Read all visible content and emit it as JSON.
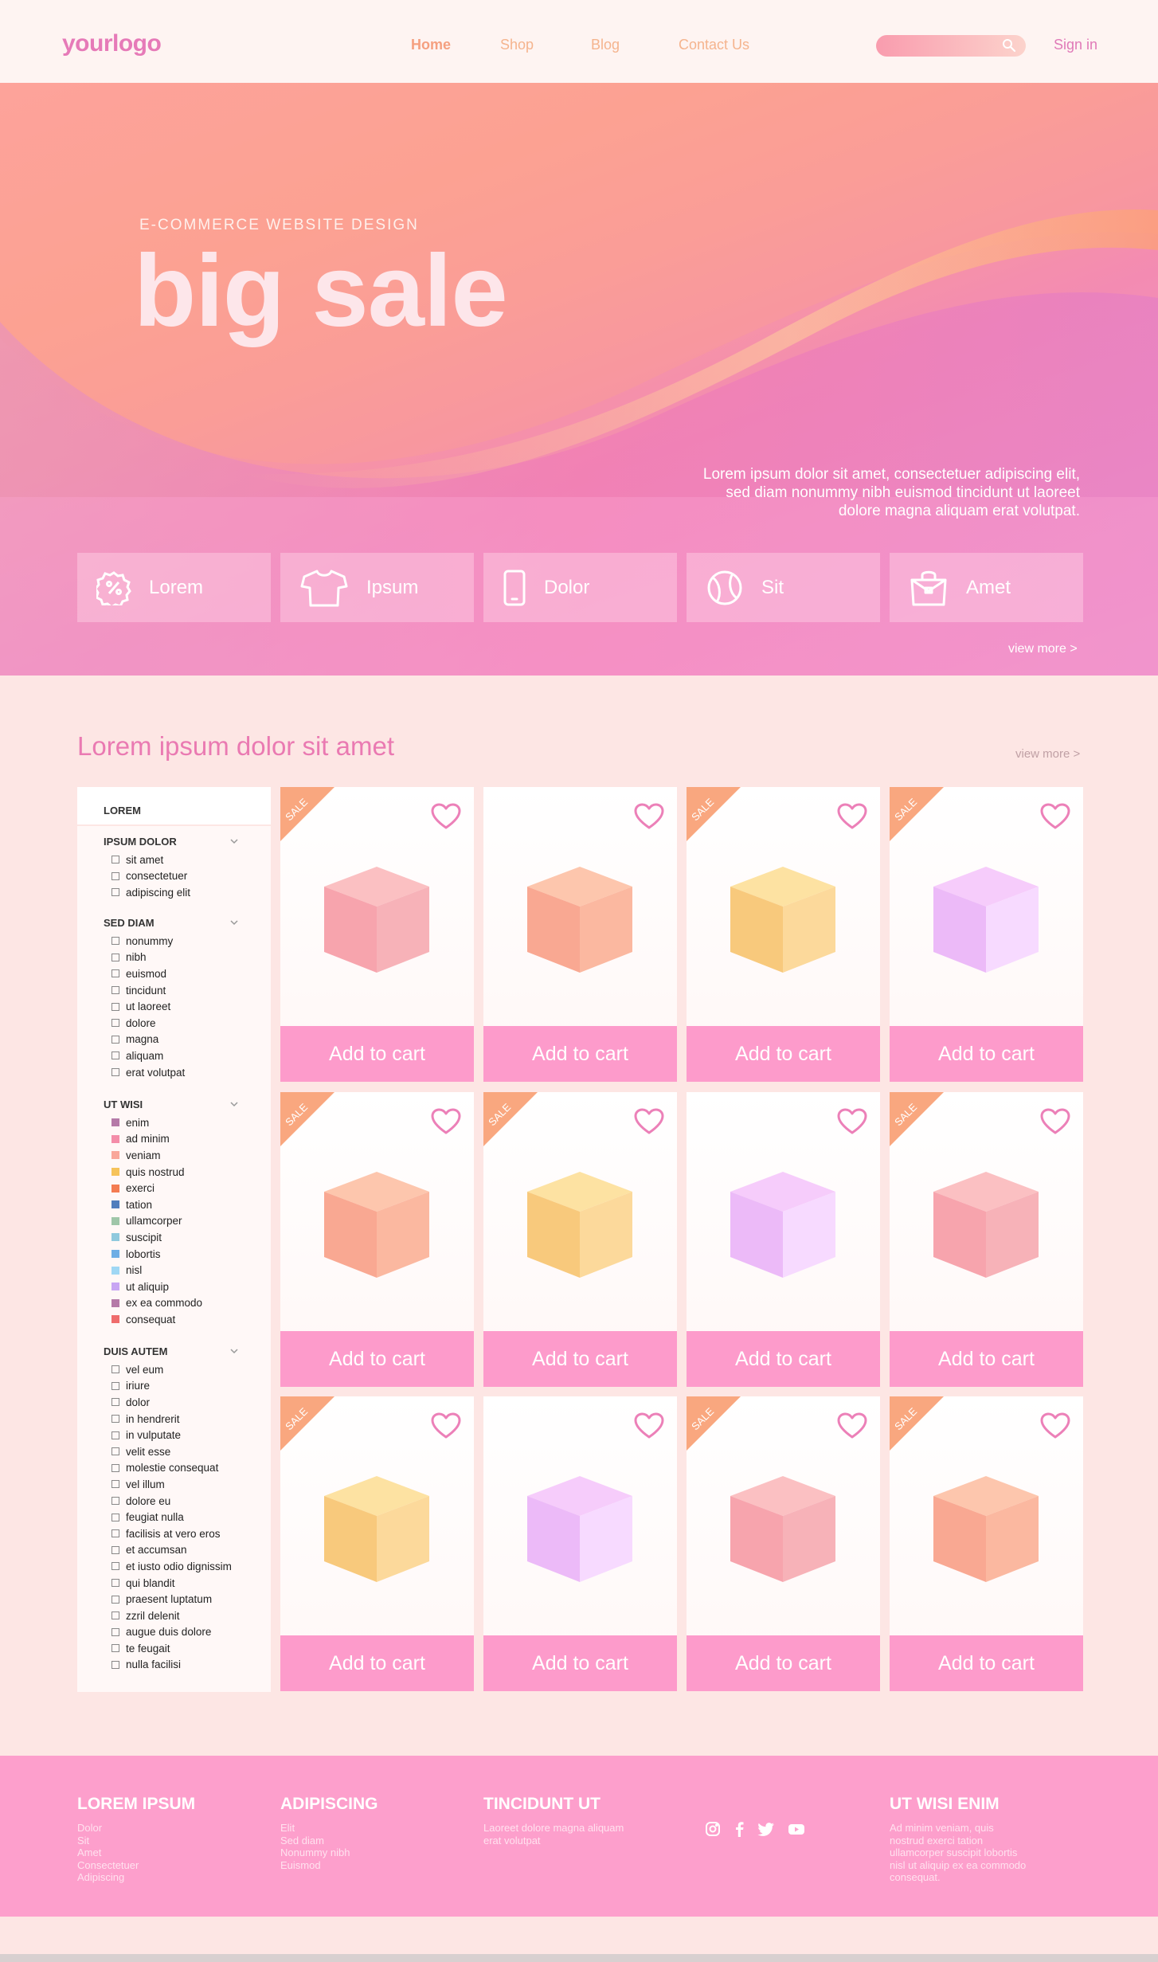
{
  "header": {
    "logo": "yourlogo",
    "nav": [
      "Home",
      "Shop",
      "Blog",
      "Contact Us"
    ],
    "sign_in": "Sign in"
  },
  "hero": {
    "subtitle": "E-COMMERCE WEBSITE DESIGN",
    "title": "big sale",
    "description": "Lorem ipsum dolor sit amet, consectetuer adipiscing elit, sed diam nonummy nibh euismod tincidunt ut laoreet dolore magna aliquam erat volutpat.",
    "categories": [
      {
        "label": "Lorem",
        "icon": "discount-badge-icon"
      },
      {
        "label": "Ipsum",
        "icon": "tshirt-icon"
      },
      {
        "label": "Dolor",
        "icon": "smartphone-icon"
      },
      {
        "label": "Sit",
        "icon": "ball-icon"
      },
      {
        "label": "Amet",
        "icon": "shopping-bag-icon"
      }
    ],
    "view_more": "view more >"
  },
  "section": {
    "title": "Lorem ipsum dolor sit amet",
    "view_more": "view more >"
  },
  "sidebar": {
    "header": "LOREM",
    "groups": [
      {
        "title": "IPSUM DOLOR",
        "items": [
          "sit amet",
          "consectetuer",
          "adipiscing elit"
        ]
      },
      {
        "title": "SED DIAM",
        "items": [
          "nonummy",
          "nibh",
          "euismod",
          "tincidunt",
          "ut laoreet",
          "dolore",
          "magna",
          "aliquam",
          "erat volutpat"
        ]
      },
      {
        "title": "UT WISI",
        "items": [
          "enim",
          "ad minim",
          "veniam",
          "quis nostrud",
          "exerci",
          "tation",
          "ullamcorper",
          "suscipit",
          "lobortis",
          "nisl",
          "ut aliquip",
          "ex ea commodo",
          "consequat"
        ],
        "colors": [
          "#b57aa8",
          "#f48da9",
          "#f9a79a",
          "#f6c35a",
          "#f47c52",
          "#4f7fbd",
          "#9fc6a9",
          "#8fc9dd",
          "#6eaee5",
          "#9fd7f4",
          "#c8a6f3",
          "#b57aa8",
          "#ef6c6c"
        ]
      },
      {
        "title": "DUIS AUTEM",
        "items": [
          "vel eum",
          "iriure",
          "dolor",
          "in hendrerit",
          "in vulputate",
          "velit esse",
          "molestie consequat",
          "vel illum",
          "dolore eu",
          "feugiat nulla",
          "facilisis at vero eros",
          "et accumsan",
          "et iusto odio dignissim",
          "qui blandit",
          "praesent luptatum",
          "zzril delenit",
          "augue duis dolore",
          "te feugait",
          "nulla facilisi"
        ]
      }
    ]
  },
  "products": [
    {
      "sale": true,
      "color": "pink"
    },
    {
      "sale": false,
      "color": "peach"
    },
    {
      "sale": true,
      "color": "yellow"
    },
    {
      "sale": true,
      "color": "lilac"
    },
    {
      "sale": true,
      "color": "peach"
    },
    {
      "sale": true,
      "color": "yellow"
    },
    {
      "sale": false,
      "color": "lilac"
    },
    {
      "sale": true,
      "color": "pink"
    },
    {
      "sale": true,
      "color": "yellow"
    },
    {
      "sale": false,
      "color": "lilac"
    },
    {
      "sale": true,
      "color": "pink"
    },
    {
      "sale": true,
      "color": "peach"
    }
  ],
  "product_labels": {
    "add_to_cart": "Add to cart",
    "sale": "SALE"
  },
  "footer": {
    "columns": [
      {
        "title": "LOREM IPSUM",
        "lines": [
          "Dolor",
          "Sit",
          "Amet",
          "Consectetuer",
          "Adipiscing"
        ]
      },
      {
        "title": "ADIPISCING",
        "lines": [
          "Elit",
          "Sed diam",
          "Nonummy nibh",
          "Euismod"
        ]
      },
      {
        "title": "TINCIDUNT UT",
        "lines": [
          "Laoreet dolore magna aliquam",
          "erat volutpat"
        ]
      },
      {
        "title": "UT WISI ENIM",
        "lines": [
          "Ad minim veniam, quis",
          "nostrud exerci tation",
          "ullamcorper suscipit lobortis",
          "nisl ut aliquip ex ea commodo",
          "consequat."
        ]
      }
    ],
    "social": [
      "instagram-icon",
      "facebook-icon",
      "twitter-icon",
      "youtube-icon"
    ]
  },
  "colors": {
    "accent": "#fd9bcb",
    "brand": "#e67ab8",
    "title": "#ea7ab2"
  }
}
